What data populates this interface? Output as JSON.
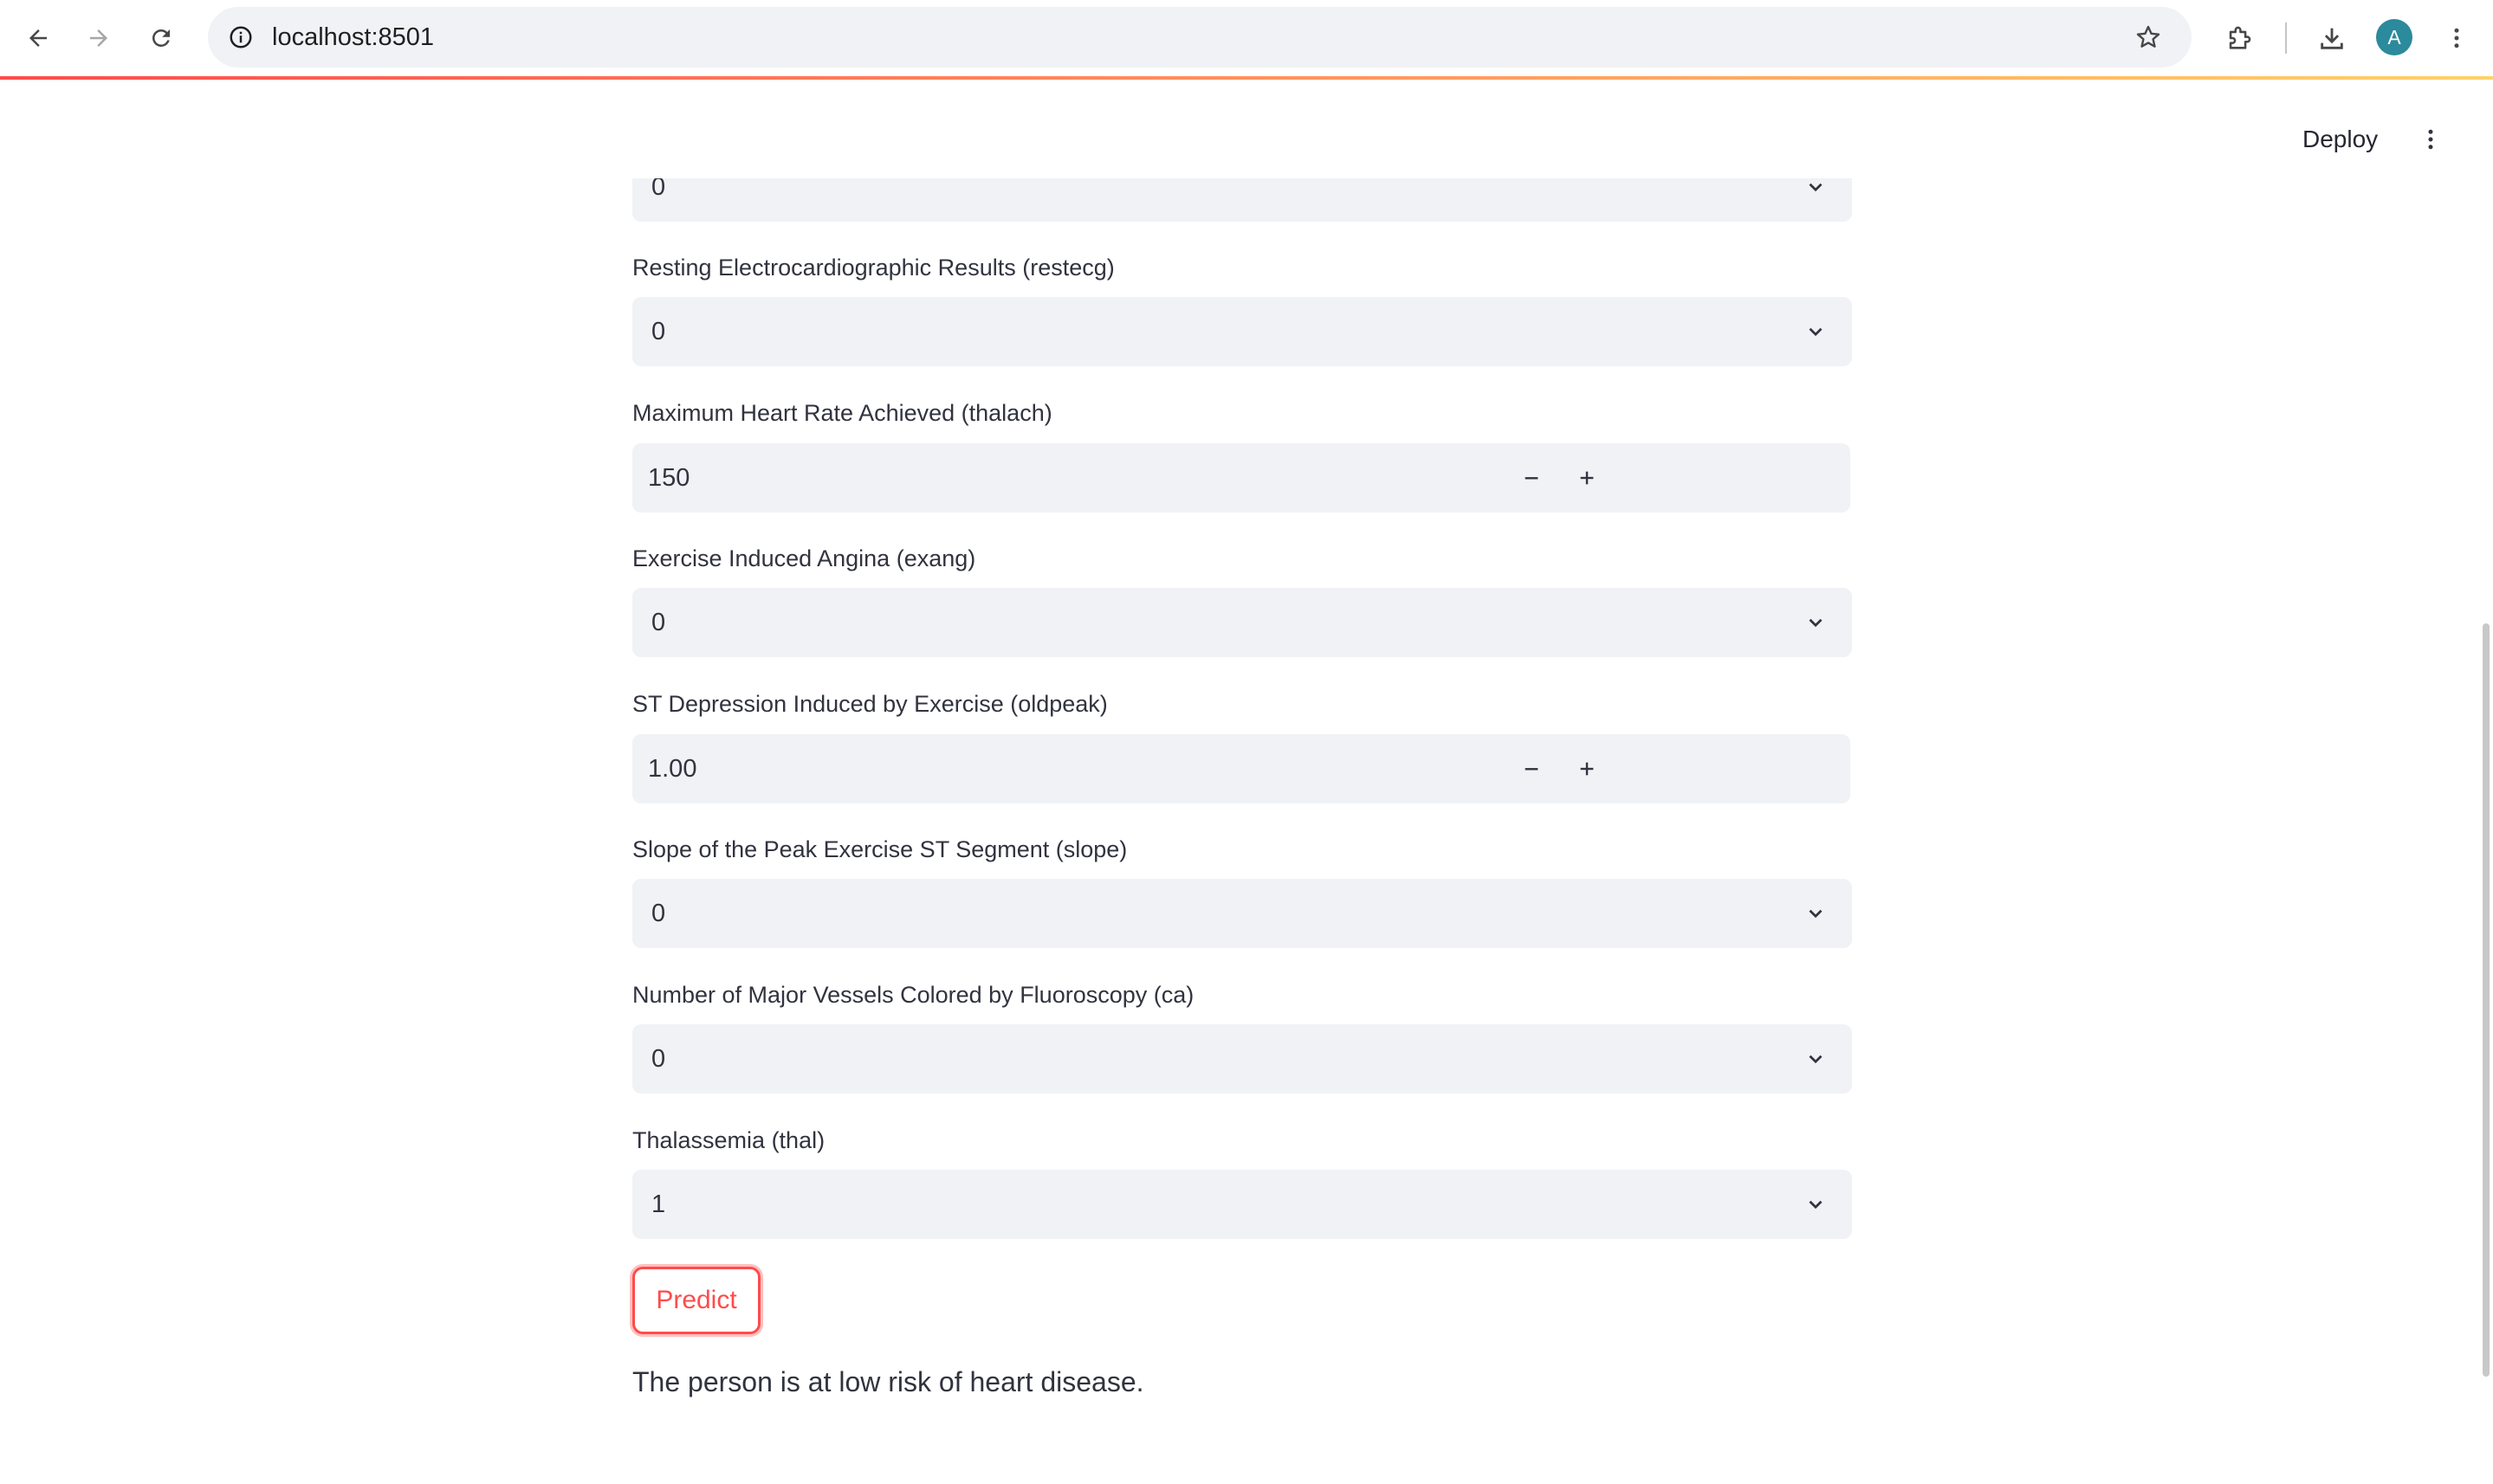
{
  "browser": {
    "url": "localhost:8501",
    "profile_initial": "A",
    "icons": {
      "back": "arrow-left-icon",
      "forward": "arrow-right-icon",
      "reload": "reload-icon",
      "site_info": "info-icon",
      "bookmark": "star-icon",
      "extensions": "puzzle-icon",
      "downloads": "download-icon",
      "menu": "kebab-menu-icon"
    }
  },
  "app_header": {
    "deploy_label": "Deploy"
  },
  "form": {
    "top_partial": {
      "value": "0"
    },
    "restecg": {
      "label": "Resting Electrocardiographic Results (restecg)",
      "value": "0"
    },
    "thalach": {
      "label": "Maximum Heart Rate Achieved (thalach)",
      "value": "150"
    },
    "exang": {
      "label": "Exercise Induced Angina (exang)",
      "value": "0"
    },
    "oldpeak": {
      "label": "ST Depression Induced by Exercise (oldpeak)",
      "value": "1.00"
    },
    "slope": {
      "label": "Slope of the Peak Exercise ST Segment (slope)",
      "value": "0"
    },
    "ca": {
      "label": "Number of Major Vessels Colored by Fluoroscopy (ca)",
      "value": "0"
    },
    "thal": {
      "label": "Thalassemia (thal)",
      "value": "1"
    }
  },
  "predict_button": {
    "label": "Predict"
  },
  "result_text": "The person is at low risk of heart disease.",
  "colors": {
    "accent": "#ff4b4b",
    "input_bg": "#f0f2f6",
    "text": "#31333f"
  }
}
